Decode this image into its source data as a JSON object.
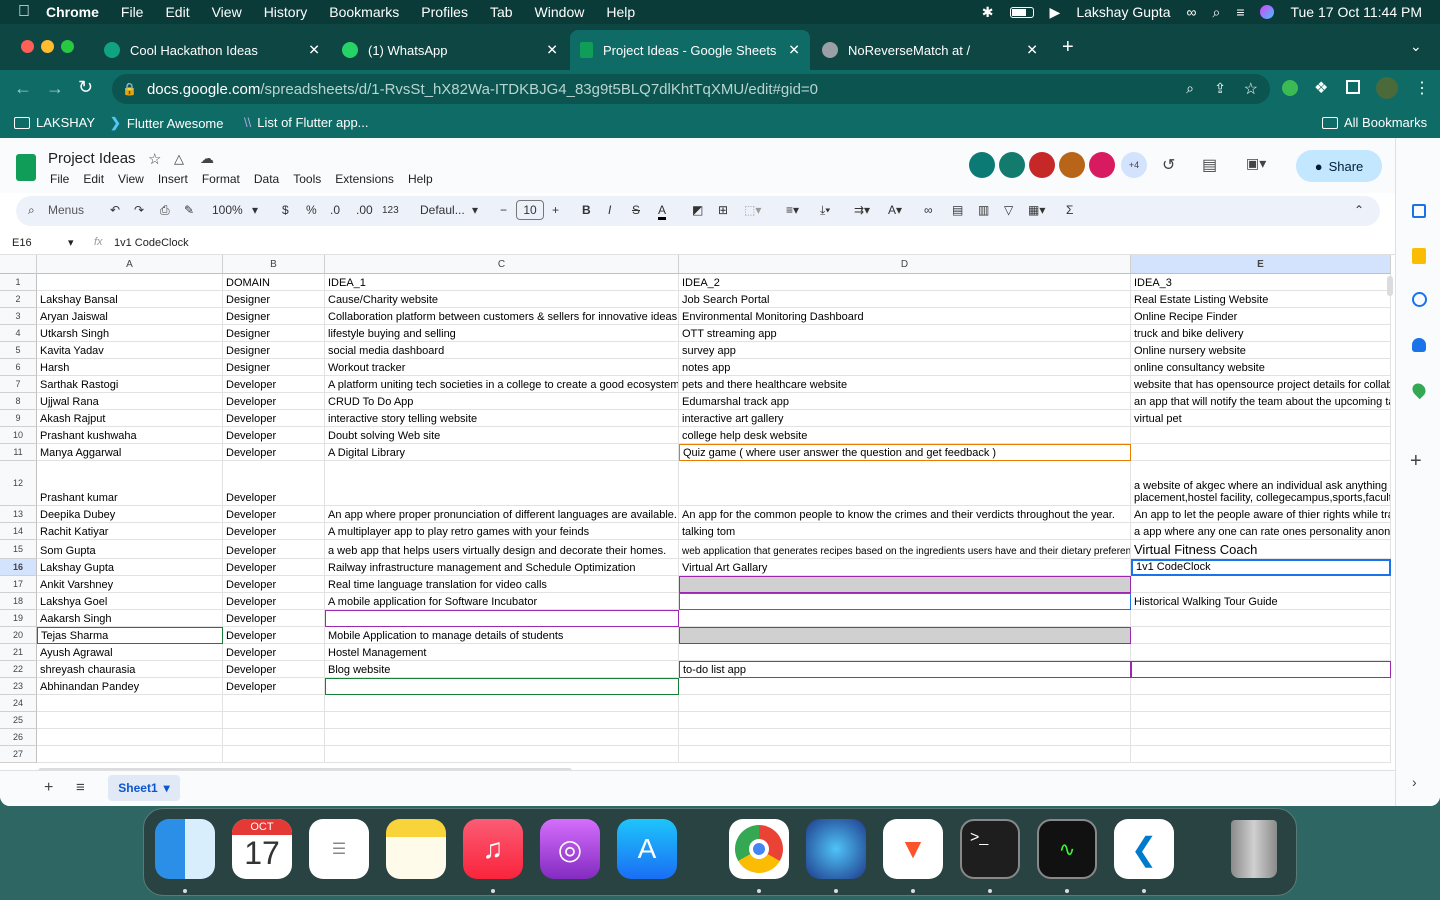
{
  "menubar": {
    "app": "Chrome",
    "items": [
      "File",
      "Edit",
      "View",
      "History",
      "Bookmarks",
      "Profiles",
      "Tab",
      "Window",
      "Help"
    ],
    "user": "Lakshay Gupta",
    "datetime": "Tue 17 Oct  11:44 PM"
  },
  "tabs": [
    {
      "label": "Cool Hackathon Ideas",
      "icon_color": "#10a37f"
    },
    {
      "label": "(1) WhatsApp",
      "icon_color": "#25d366"
    },
    {
      "label": "Project Ideas - Google Sheets",
      "icon_color": "#0f9d58"
    },
    {
      "label": "NoReverseMatch at /",
      "icon_color": "#9aa0a6"
    }
  ],
  "url": {
    "host": "docs.google.com",
    "path": "/spreadsheets/d/1-RvsSt_hX82Wa-ITDKBJG4_83g9t5BLQ7dlKhtTqXMU/edit#gid=0"
  },
  "bookmarks": [
    "LAKSHAY",
    "Flutter Awesome",
    "List of Flutter app...",
    "All Bookmarks"
  ],
  "doc": {
    "title": "Project Ideas",
    "menu": [
      "File",
      "Edit",
      "View",
      "Insert",
      "Format",
      "Data",
      "Tools",
      "Extensions",
      "Help"
    ],
    "share": "Share",
    "extra_collaborators": "+4"
  },
  "toolbar": {
    "search": "Menus",
    "zoom": "100%",
    "currency": "$",
    "percent": "%",
    "dec_less": ".0",
    "dec_more": ".00",
    "format": "123",
    "font": "Defaul...",
    "font_size": "10"
  },
  "formula": {
    "cell_ref": "E16",
    "fx": "fx",
    "value": "1v1 CodeClock"
  },
  "columns": [
    "A",
    "B",
    "C",
    "D",
    "E"
  ],
  "rows": [
    {
      "n": "1",
      "a": "",
      "b": "DOMAIN",
      "c": "IDEA_1",
      "d": "IDEA_2",
      "e": "IDEA_3"
    },
    {
      "n": "2",
      "a": "Lakshay Bansal",
      "b": "Designer",
      "c": "Cause/Charity website",
      "d": "Job Search Portal",
      "e": "Real Estate Listing Website"
    },
    {
      "n": "3",
      "a": "Aryan Jaiswal",
      "b": "Designer",
      "c": "Collaboration platform between customers & sellers for innovative ideas",
      "d": "Environmental Monitoring Dashboard",
      "e": "Online Recipe Finder"
    },
    {
      "n": "4",
      "a": "Utkarsh Singh",
      "b": "Designer",
      "c": "lifestyle buying and selling",
      "d": "OTT streaming app",
      "e": "truck and bike delivery"
    },
    {
      "n": "5",
      "a": "Kavita Yadav",
      "b": "Designer",
      "c": "social media dashboard",
      "d": "survey app",
      "e": "Online nursery website"
    },
    {
      "n": "6",
      "a": "Harsh",
      "b": "Designer",
      "c": "Workout tracker",
      "d": "notes app",
      "e": "online consultancy website"
    },
    {
      "n": "7",
      "a": "Sarthak Rastogi",
      "b": "Developer",
      "c": "A platform uniting tech societies in a college to create a good ecosystem",
      "d": "pets and there healthcare website",
      "e": "website that has opensource project details for collab"
    },
    {
      "n": "8",
      "a": "Ujjwal Rana",
      "b": "Developer",
      "c": "CRUD  To Do App",
      "d": "Edumarshal track app",
      "e": "an app that will notify the team about the upcoming ta"
    },
    {
      "n": "9",
      "a": "Akash Rajput",
      "b": "Developer",
      "c": "interactive story telling website",
      "d": "interactive art gallery",
      "e": "virtual pet"
    },
    {
      "n": "10",
      "a": "Prashant kushwaha",
      "b": "Developer",
      "c": "Doubt solving Web site",
      "d": "college help desk website",
      "e": ""
    },
    {
      "n": "11",
      "a": "Manya Aggarwal",
      "b": "Developer",
      "c": "A Digital Library",
      "d": "Quiz game ( where user answer the question and get feedback )",
      "e": ""
    },
    {
      "n": "12",
      "a": "Prashant kumar",
      "b": "Developer",
      "c": "",
      "d": "",
      "e": "a  website of akgec where an individual ask anything",
      "e2": "placement,hostel facility, collegecampus,sports,faculty"
    },
    {
      "n": "13",
      "a": "Deepika Dubey",
      "b": "Developer",
      "c": "An app where  proper pronunciation of different languages are available.",
      "d": "An app for the common people to know the crimes and their verdicts throughout the year.",
      "e": "An app to let the people aware of thier rights while tra"
    },
    {
      "n": "14",
      "a": "Rachit Katiyar",
      "b": "Developer",
      "c": "A multiplayer app to play retro games with your feinds",
      "d": "talking tom",
      "e": "a app where any one can rate ones personality anoni"
    },
    {
      "n": "15",
      "a": "Som Gupta",
      "b": "Developer",
      "c": " a web app that helps users virtually design and decorate their homes.",
      "d": "web application that generates recipes based on the ingredients users have and their dietary preferences",
      "e": "Virtual Fitness Coach"
    },
    {
      "n": "16",
      "a": "Lakshay Gupta",
      "b": "Developer",
      "c": "Railway infrastructure management and Schedule Optimization",
      "d": "Virtual Art Gallary",
      "e": "1v1 CodeClock"
    },
    {
      "n": "17",
      "a": "Ankit Varshney",
      "b": "Developer",
      "c": "Real time language translation for video calls",
      "d": "",
      "e": ""
    },
    {
      "n": "18",
      "a": "Lakshya Goel",
      "b": "Developer",
      "c": "A mobile application for Software Incubator",
      "d": "",
      "e": "Historical Walking Tour Guide"
    },
    {
      "n": "19",
      "a": "Aakarsh Singh",
      "b": "Developer",
      "c": "",
      "d": "",
      "e": ""
    },
    {
      "n": "20",
      "a": "Tejas Sharma",
      "b": "Developer",
      "c": "Mobile Application to manage details of students",
      "d": "",
      "e": ""
    },
    {
      "n": "21",
      "a": "Ayush Agrawal",
      "b": "Developer",
      "c": "Hostel Management",
      "d": "",
      "e": ""
    },
    {
      "n": "22",
      "a": "shreyash chaurasia",
      "b": "Developer",
      "c": "Blog website",
      "d": "to-do list app",
      "e": ""
    },
    {
      "n": "23",
      "a": "Abhinandan Pandey",
      "b": "Developer",
      "c": "",
      "d": "",
      "e": ""
    },
    {
      "n": "24",
      "a": "",
      "b": "",
      "c": "",
      "d": "",
      "e": ""
    },
    {
      "n": "25",
      "a": "",
      "b": "",
      "c": "",
      "d": "",
      "e": ""
    },
    {
      "n": "26",
      "a": "",
      "b": "",
      "c": "",
      "d": "",
      "e": ""
    },
    {
      "n": "27",
      "a": "",
      "b": "",
      "c": "",
      "d": "",
      "e": ""
    }
  ],
  "sheet_tab": "Sheet1",
  "dock": {
    "calendar_month": "OCT",
    "calendar_day": "17"
  }
}
